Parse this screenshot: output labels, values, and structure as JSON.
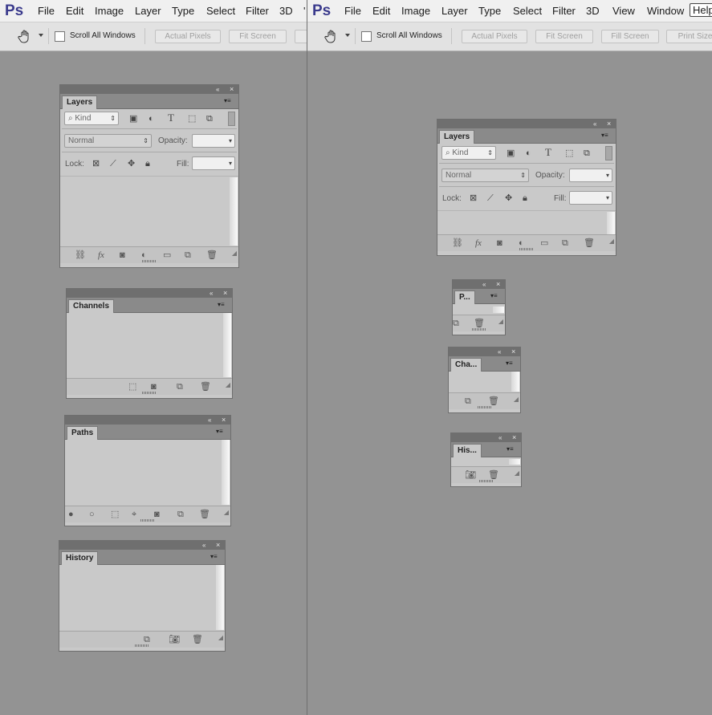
{
  "app": {
    "logo": "Ps",
    "menu": [
      "File",
      "Edit",
      "Image",
      "Layer",
      "Type",
      "Select",
      "Filter",
      "3D",
      "View",
      "Window",
      "Help"
    ],
    "left_menu_overflow": "'"
  },
  "options_bar": {
    "scroll_all_windows": "Scroll All Windows",
    "actual_pixels": "Actual Pixels",
    "fit_screen": "Fit Screen",
    "fill_screen": "Fill Screen",
    "print_size": "Print Size"
  },
  "icons": {
    "hand": "hand-tool-icon",
    "collapse": "«",
    "close": "×",
    "panel_menu": "▾≡",
    "search": "⌕",
    "updown": "⇕",
    "dropdown": "▾"
  },
  "panels": {
    "layers": {
      "tab": "Layers",
      "kind": "Kind",
      "blend_mode": "Normal",
      "opacity_label": "Opacity:",
      "lock_label": "Lock:",
      "fill_label": "Fill:"
    },
    "channels": {
      "tab": "Channels",
      "tab_short": "Cha..."
    },
    "paths": {
      "tab": "Paths",
      "tab_short": "P..."
    },
    "history": {
      "tab": "History",
      "tab_short": "His..."
    }
  },
  "colors": {
    "workspace": "#939393",
    "menubar": "#f0f0f0",
    "panel_bg": "#c9c9c9",
    "panel_titlebar": "#6f6f6f",
    "logo": "#3a3a8c"
  }
}
